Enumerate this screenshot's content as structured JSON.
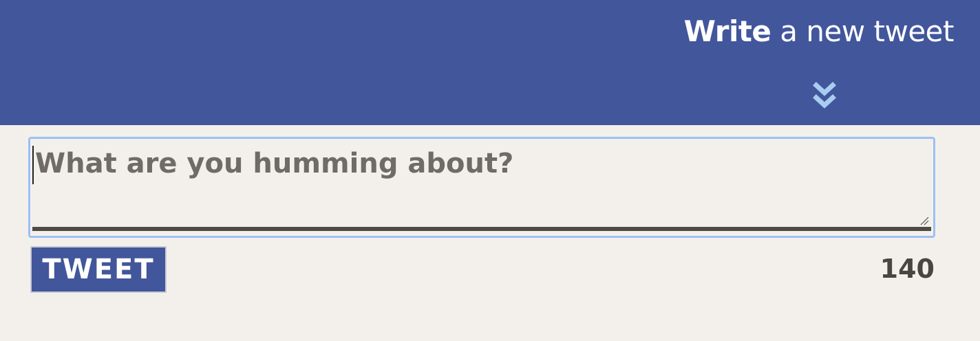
{
  "header": {
    "title_bold": "Write",
    "title_rest": " a new tweet",
    "expand_icon": "double-chevron-down-icon",
    "background_color": "#42569c",
    "icon_color": "#a9cdf0"
  },
  "compose": {
    "value": "",
    "placeholder": "What are you humming about?",
    "focus_ring_color": "#9dc0f4"
  },
  "actions": {
    "tweet_label": "TWEET",
    "char_count": "140"
  }
}
